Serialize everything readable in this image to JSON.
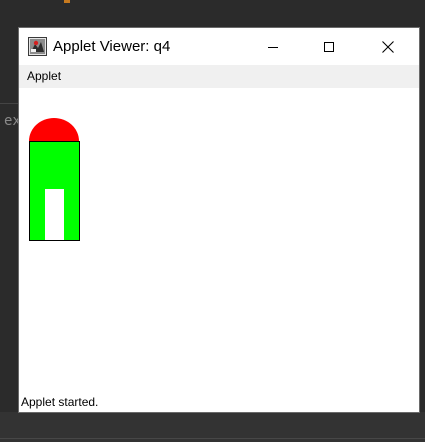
{
  "window": {
    "title": "Applet Viewer: q4",
    "icon": "java-applet-icon",
    "controls": {
      "minimize": "minimize-icon",
      "maximize": "maximize-icon",
      "close": "close-icon"
    }
  },
  "menubar": {
    "items": [
      {
        "label": "Applet"
      }
    ]
  },
  "background": {
    "editor_fragment": "ex"
  },
  "drawing": {
    "shapes": [
      "red-dome",
      "green-body",
      "white-doorway"
    ],
    "colors": {
      "dome": "#ff0000",
      "body": "#00ff00",
      "door": "#ffffff",
      "outline": "#000000"
    }
  },
  "status": {
    "text": "Applet started."
  }
}
